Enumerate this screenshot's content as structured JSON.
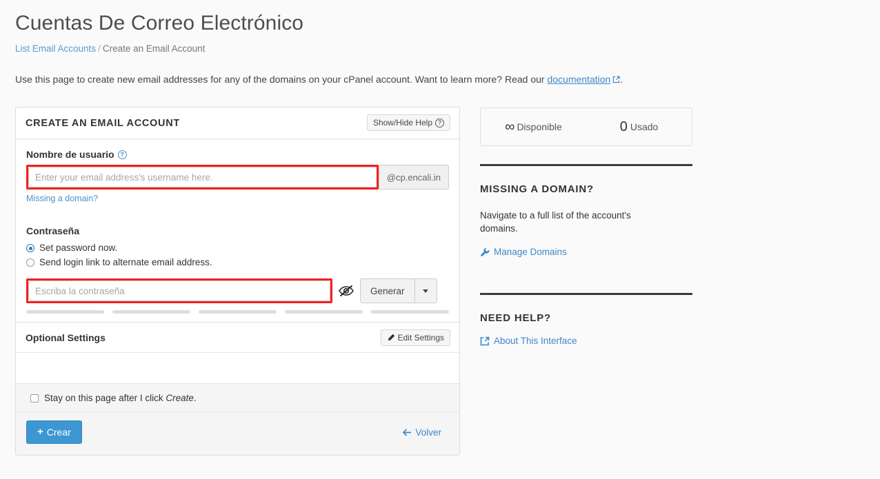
{
  "header": {
    "title": "Cuentas De Correo Electrónico",
    "breadcrumb_link": "List Email Accounts",
    "breadcrumb_sep": "/",
    "breadcrumb_current": "Create an Email Account",
    "intro_before": "Use this page to create new email addresses for any of the domains on your cPanel account. Want to learn more? Read our",
    "intro_link": "documentation",
    "intro_after": "."
  },
  "panel": {
    "title": "CREATE AN EMAIL ACCOUNT",
    "help_toggle": "Show/Hide Help",
    "username": {
      "label": "Nombre de usuario",
      "placeholder": "Enter your email address's username here.",
      "value": "",
      "domain_addon": "@cp.encali.in",
      "missing_domain_link": "Missing a domain?"
    },
    "password": {
      "label": "Contraseña",
      "option_set_now": "Set password now.",
      "option_send_link": "Send login link to alternate email address.",
      "selected_option": "Set password now.",
      "placeholder": "Escriba la contraseña",
      "value": "",
      "generate_label": "Generar",
      "strength_segments": 5
    },
    "optional": {
      "title": "Optional Settings",
      "edit_label": "Edit Settings"
    },
    "footer": {
      "stay_prefix": "Stay on this page after I click",
      "stay_emphasis": "Create",
      "stay_suffix": ".",
      "checkbox_checked": false,
      "create_label": "Crear",
      "back_label": "Volver"
    }
  },
  "sidebar": {
    "stats": {
      "available_value": "∞",
      "available_label": "Disponible",
      "used_value": "0",
      "used_label": "Usado"
    },
    "missing_domain": {
      "heading": "MISSING A DOMAIN?",
      "text": "Navigate to a full list of the account's domains.",
      "link": "Manage Domains"
    },
    "need_help": {
      "heading": "NEED HELP?",
      "link": "About This Interface"
    }
  },
  "colors": {
    "primary_blue": "#3d97d3",
    "link_blue": "#3d87c9",
    "highlight_red": "#f42020",
    "page_bg": "#fafafa"
  }
}
